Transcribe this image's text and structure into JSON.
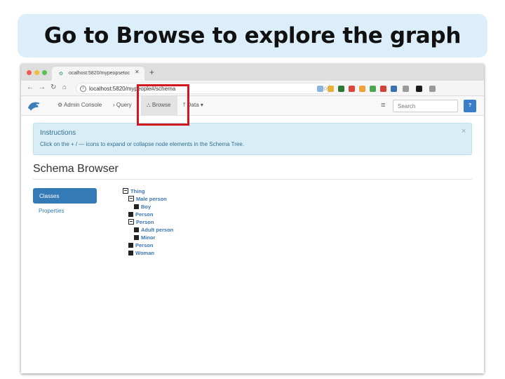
{
  "slide": {
    "title": "Go to Browse to explore the graph"
  },
  "browser": {
    "tab_title": "ocalhost:5820/mypeopsetoc",
    "tab_close": "✕",
    "new_tab": "+",
    "url": "localhost:5820/mypeople#/schema",
    "nav": {
      "back": "←",
      "forward": "→",
      "reload": "↻",
      "home": "⌂"
    },
    "star": "☆",
    "info": "i",
    "extensions": [
      "#8bb3e0",
      "#e8b23a",
      "#2a7b2f",
      "#d9483b",
      "#f0a23a",
      "#4aa64f",
      "#d2403a",
      "#3a6fb3",
      "#9a9a9a",
      "#1a1a1a",
      "#9a9a9a"
    ]
  },
  "app": {
    "nav": {
      "admin_console": "Admin Console",
      "query": "Query",
      "browse": "Browse",
      "data": "Data",
      "search_placeholder": "Search",
      "help": "?"
    },
    "instructions": {
      "title": "Instructions",
      "text": "Click on the + / — icons to expand or collapse node elements in the Schema Tree.",
      "close": "×"
    },
    "page_title": "Schema Browser",
    "pills": {
      "classes": "Classes",
      "properties": "Properties"
    },
    "tree": [
      {
        "label": "Thing",
        "kind": "expanded"
      },
      {
        "label": "Male person",
        "kind": "expanded"
      },
      {
        "label": "Boy",
        "kind": "leaf"
      },
      {
        "label": "Person",
        "kind": "leaf"
      },
      {
        "label": "Person",
        "kind": "expanded"
      },
      {
        "label": "Adult person",
        "kind": "leaf"
      },
      {
        "label": "Minor",
        "kind": "leaf"
      },
      {
        "label": "Person",
        "kind": "leaf"
      },
      {
        "label": "Woman",
        "kind": "leaf"
      }
    ]
  },
  "colors": {
    "highlight": "#d2161e",
    "accent": "#337ab7"
  }
}
